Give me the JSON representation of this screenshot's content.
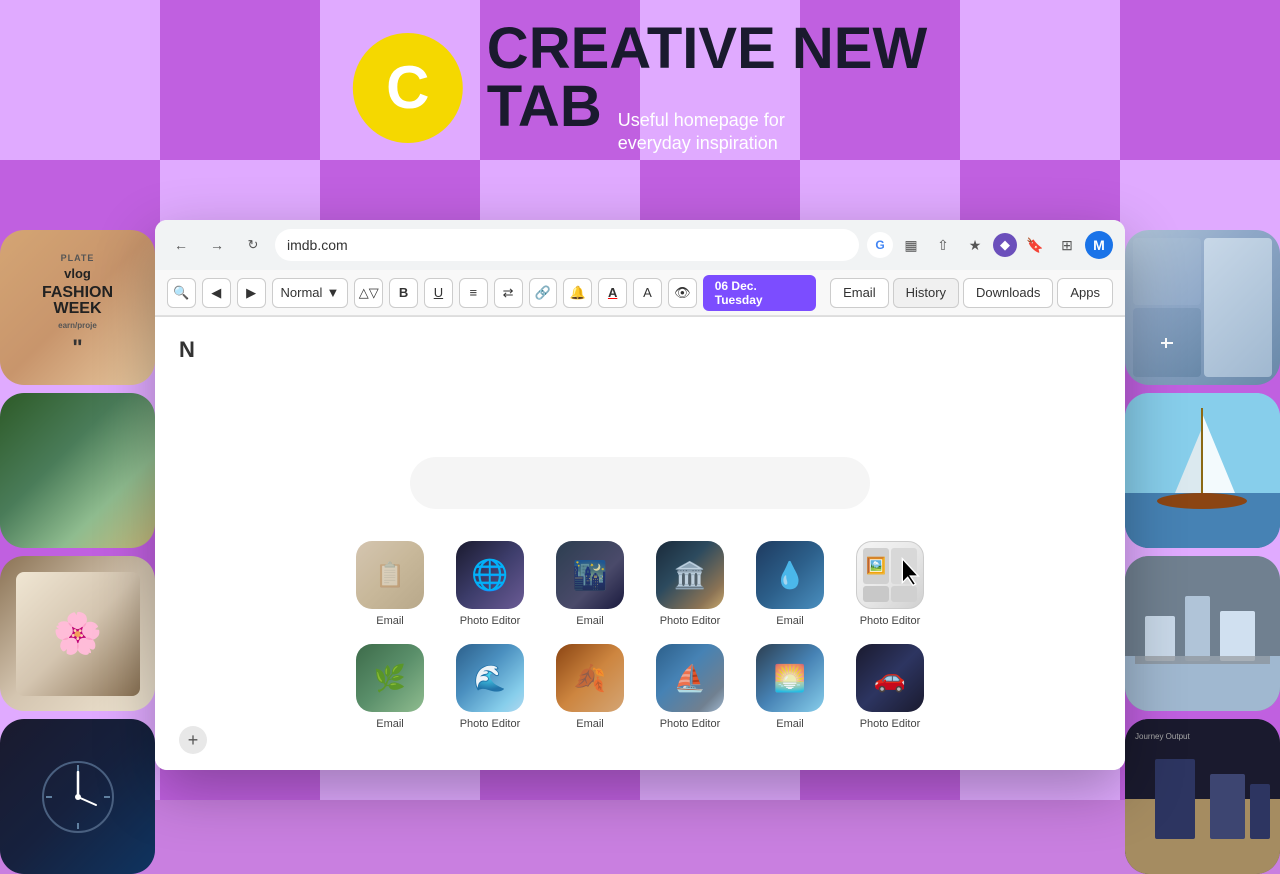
{
  "background": {
    "colors": {
      "light_cell": "#e0aaff",
      "dark_cell": "#c060e0"
    }
  },
  "header": {
    "logo_letter": "C",
    "title_line1": "CREATIVE NEW",
    "title_line2": "TAB",
    "subtitle_line1": "Useful homepage for",
    "subtitle_line2": "everyday inspiration"
  },
  "browser": {
    "address": "imdb.com",
    "toolbar": {
      "text_style": "Normal",
      "bold": "B",
      "underline": "U",
      "date": "06 Dec. Tuesday",
      "email_btn": "Email",
      "history_btn": "History",
      "downloads_btn": "Downloads",
      "apps_btn": "Apps"
    },
    "content": {
      "letter": "N",
      "search_placeholder": ""
    },
    "apps_row1": [
      {
        "label": "Email",
        "icon_class": "icon-email-1"
      },
      {
        "label": "Photo Editor",
        "icon_class": "icon-photo-1"
      },
      {
        "label": "Email",
        "icon_class": "icon-email-2"
      },
      {
        "label": "Photo Editor",
        "icon_class": "icon-photo-2"
      },
      {
        "label": "Email",
        "icon_class": "icon-email-3"
      },
      {
        "label": "Photo Editor",
        "icon_class": "icon-photo-active"
      }
    ],
    "apps_row2": [
      {
        "label": "Email",
        "icon_class": "icon-email-4"
      },
      {
        "label": "Photo Editor",
        "icon_class": "icon-photo-4"
      },
      {
        "label": "Email",
        "icon_class": "icon-email-5"
      },
      {
        "label": "Photo Editor",
        "icon_class": "icon-photo-5"
      },
      {
        "label": "Email",
        "icon_class": "icon-email-6"
      },
      {
        "label": "Photo Editor",
        "icon_class": "icon-photo-6"
      }
    ],
    "add_button": "+",
    "profile_letter": "M"
  }
}
